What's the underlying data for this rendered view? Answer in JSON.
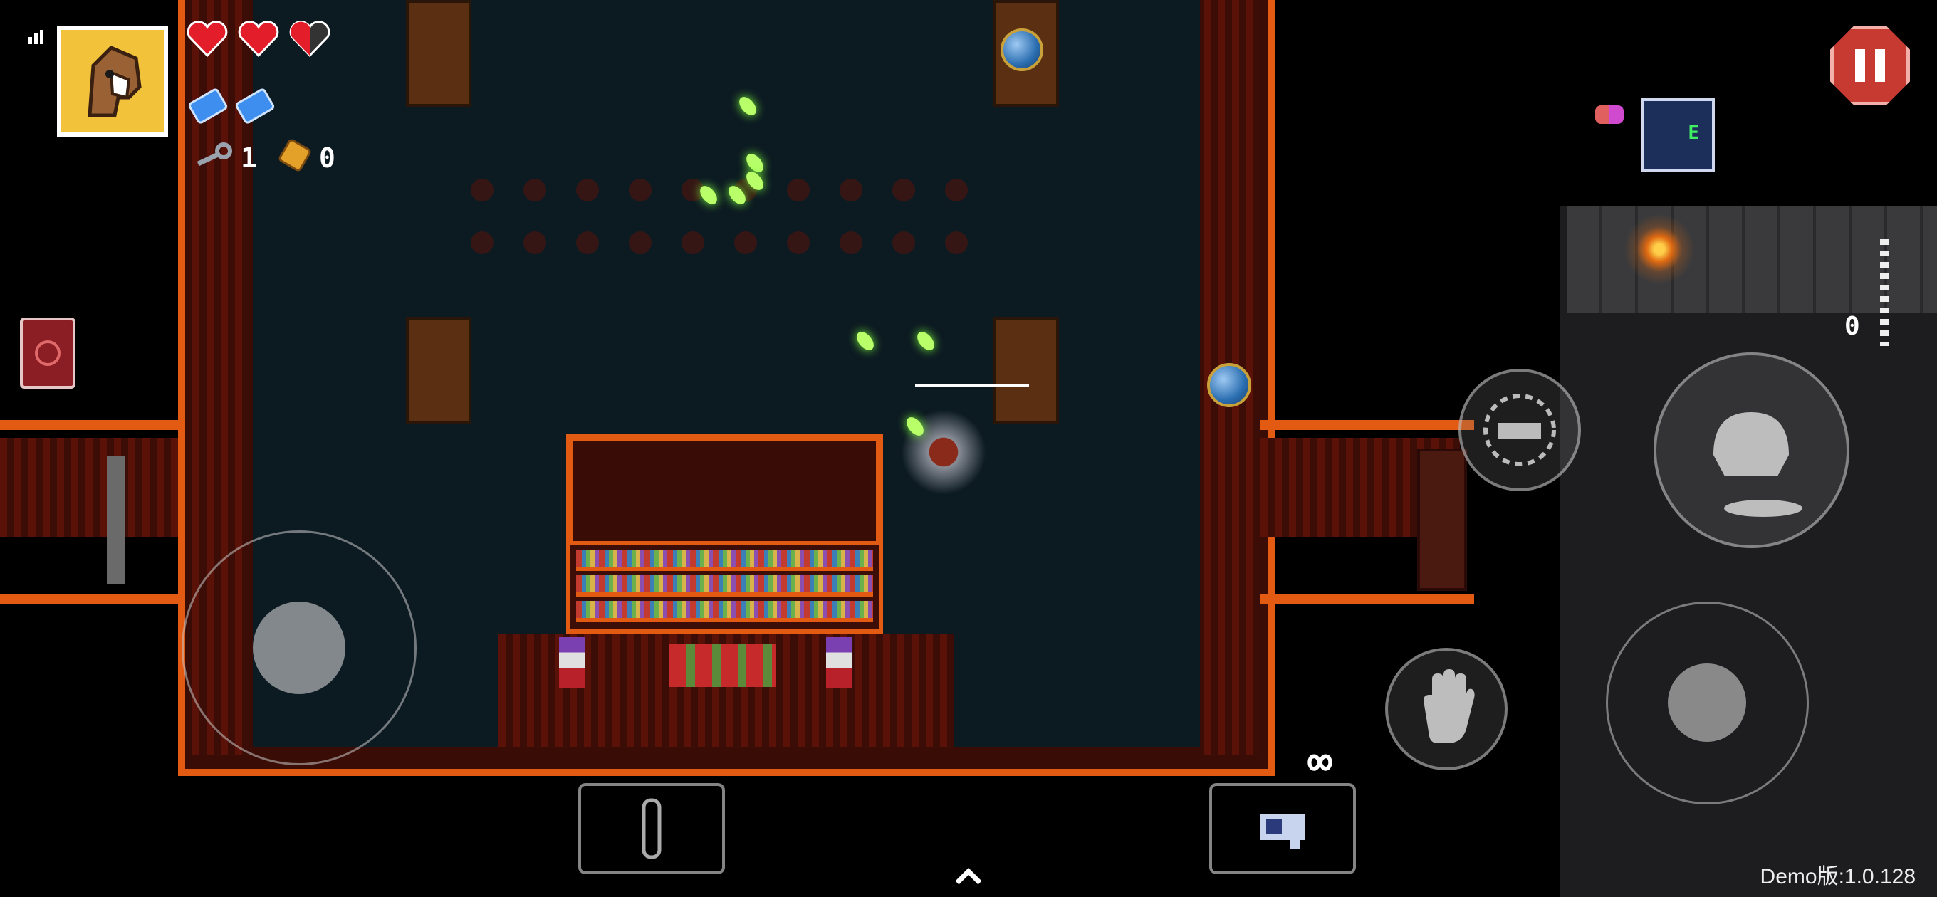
{
  "hud": {
    "hearts": {
      "full": 2,
      "half": 1
    },
    "blanks": 2,
    "keys": "1",
    "shells": "0",
    "signal_icon": "signal-bars-icon",
    "portrait_icon": "horse-portrait-icon",
    "item_icon": "red-book-icon",
    "ammo_count": "∞",
    "ammo_counter_value": "0",
    "version": "Demo版:1.0.128"
  },
  "buttons": {
    "pause_icon": "pause-icon",
    "dodge_icon": "dodge-roll-icon",
    "interact_icon": "hand-icon",
    "reload_icon": "reload-icon",
    "active_item_icon": "active-item-icon",
    "gun_icon": "gun-icon",
    "expand_icon": "chevron-up-icon"
  },
  "minimap": {
    "label": "E"
  },
  "colors": {
    "accent": "#e35b12",
    "pause": "#c73a32",
    "bullet": "#b8ff6a",
    "heart": "#e41d2a",
    "blank": "#3e8ef0"
  }
}
